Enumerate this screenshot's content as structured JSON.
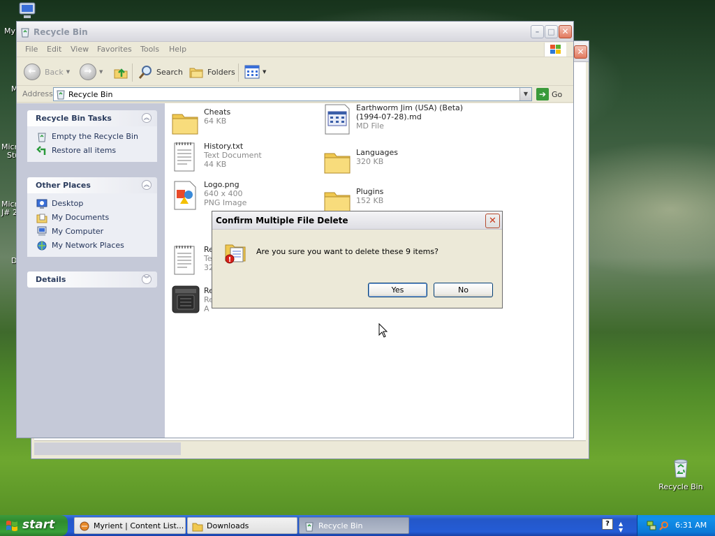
{
  "desktop": {
    "fragments": [
      "My",
      "M",
      "Micro",
      "Stu",
      "Micro",
      "J# 2",
      "D"
    ],
    "recycle_bin_label": "Recycle Bin"
  },
  "window": {
    "title": "Recycle Bin",
    "menu": [
      "File",
      "Edit",
      "View",
      "Favorites",
      "Tools",
      "Help"
    ],
    "toolbar": {
      "back": "Back",
      "search": "Search",
      "folders": "Folders"
    },
    "address": {
      "label": "Address",
      "value": "Recycle Bin",
      "go": "Go"
    },
    "panels": {
      "tasks": {
        "title": "Recycle Bin Tasks",
        "items": [
          "Empty the Recycle Bin",
          "Restore all items"
        ]
      },
      "places": {
        "title": "Other Places",
        "items": [
          "Desktop",
          "My Documents",
          "My Computer",
          "My Network Places"
        ]
      },
      "details": {
        "title": "Details"
      }
    },
    "files": [
      {
        "name": "Cheats",
        "sub1": "64 KB",
        "sub2": "",
        "icon": "folder-icon"
      },
      {
        "name": "Earthworm Jim (USA) (Beta)",
        "name2": "(1994-07-28).md",
        "sub1": "MD File",
        "icon": "md-file-icon"
      },
      {
        "name": "History.txt",
        "sub1": "Text Document",
        "sub2": "44 KB",
        "icon": "text-document-icon"
      },
      {
        "name": "Languages",
        "sub1": "320 KB",
        "icon": "folder-icon"
      },
      {
        "name": "Logo.png",
        "sub1": "640 x 400",
        "sub2": "PNG Image",
        "icon": "png-image-icon"
      },
      {
        "name": "Plugins",
        "sub1": "152 KB",
        "icon": "folder-icon"
      },
      {
        "name": "Re",
        "sub1": "Te",
        "sub2": "32",
        "icon": "text-document-icon"
      },
      {
        "name": "Re",
        "sub1": "Re",
        "sub2": "A",
        "icon": "cartridge-icon"
      }
    ]
  },
  "dialog": {
    "title": "Confirm Multiple File Delete",
    "message": "Are you sure you want to delete these 9 items?",
    "yes": "Yes",
    "no": "No"
  },
  "taskbar": {
    "start": "start",
    "tasks": [
      "Myrient | Content List...",
      "Downloads",
      "Recycle Bin"
    ],
    "help_glyph": "?",
    "clock": "6:31 AM"
  }
}
